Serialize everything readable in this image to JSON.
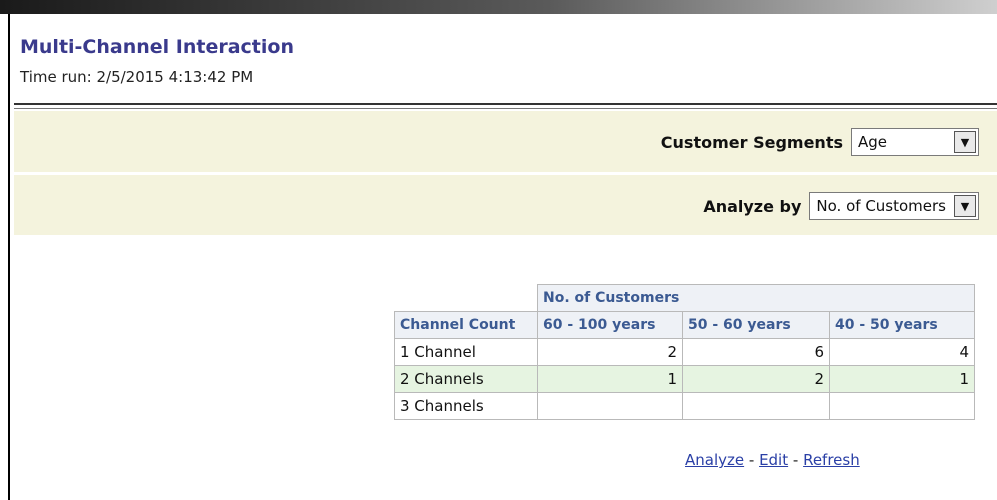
{
  "header": {
    "title": "Multi-Channel Interaction",
    "time_run": "Time run: 2/5/2015 4:13:42 PM"
  },
  "prompts": {
    "segments": {
      "label": "Customer Segments",
      "value": "Age"
    },
    "analyze_by": {
      "label": "Analyze by",
      "value": "No. of Customers"
    }
  },
  "table": {
    "measure_header": "No. of Customers",
    "row_header": "Channel Count",
    "columns": [
      "60 - 100 years",
      "50 - 60 years",
      "40 - 50 years"
    ],
    "rows": [
      {
        "label": "1 Channel",
        "values": [
          "2",
          "6",
          "4"
        ]
      },
      {
        "label": "2 Channels",
        "values": [
          "1",
          "2",
          "1"
        ]
      },
      {
        "label": "3 Channels",
        "values": [
          "",
          "",
          ""
        ]
      }
    ]
  },
  "links": {
    "analyze": "Analyze",
    "sep1": " - ",
    "edit": "Edit",
    "sep2": " - ",
    "refresh": "Refresh"
  }
}
